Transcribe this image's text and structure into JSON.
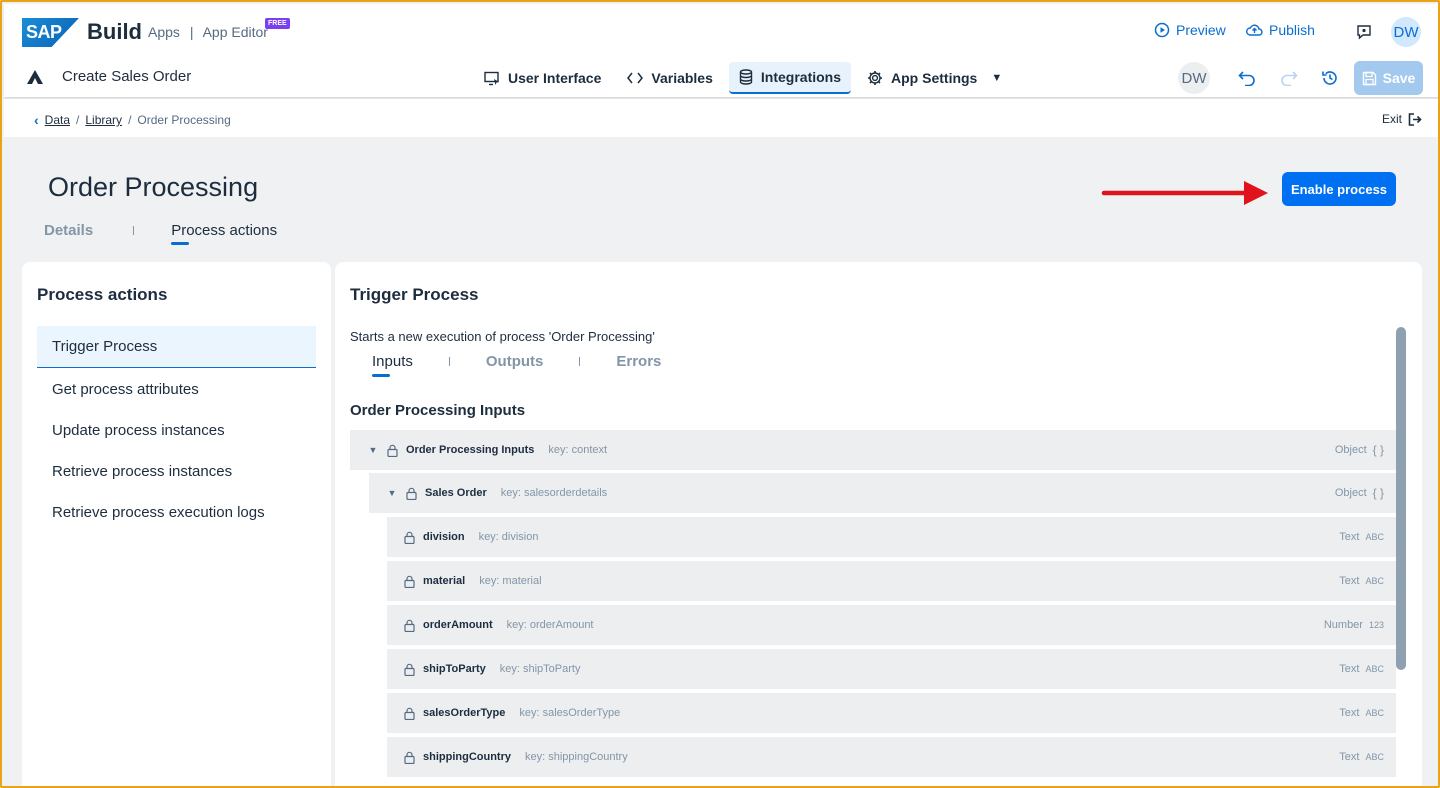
{
  "header": {
    "logo_text": "SAP",
    "product": "Build",
    "crumb_apps": "Apps",
    "crumb_sep": "|",
    "crumb_editor": "App Editor",
    "free_badge": "FREE",
    "preview_label": "Preview",
    "publish_label": "Publish",
    "user_initials": "DW",
    "app_name": "Create Sales Order",
    "tabs": [
      {
        "label": "User Interface",
        "icon": "user-interface-icon"
      },
      {
        "label": "Variables",
        "icon": "code-icon"
      },
      {
        "label": "Integrations",
        "icon": "database-icon",
        "active": true
      },
      {
        "label": "App Settings",
        "icon": "gear-icon"
      }
    ],
    "collaborator_initials": "DW",
    "save_label": "Save",
    "accent": "#0a6ed1"
  },
  "breadcrumb": {
    "items": [
      "Data",
      "Library",
      "Order Processing"
    ],
    "sep": "/",
    "exit_label": "Exit"
  },
  "page": {
    "title": "Order Processing",
    "tabs": [
      "Details",
      "Process actions"
    ],
    "active_tab": "Process actions",
    "enable_button": "Enable process"
  },
  "left_panel": {
    "title": "Process actions",
    "items": [
      "Trigger Process",
      "Get process attributes",
      "Update process instances",
      "Retrieve process instances",
      "Retrieve process execution logs"
    ]
  },
  "right_panel": {
    "title": "Trigger Process",
    "description": "Starts a new execution of process 'Order Processing'",
    "tabs": [
      "Inputs",
      "Outputs",
      "Errors"
    ],
    "section_title": "Order Processing Inputs",
    "rows": [
      {
        "name": "Order Processing Inputs",
        "key": "key: context",
        "type": "Object",
        "type_icon": "{ }"
      },
      {
        "name": "Sales Order",
        "key": "key: salesorderdetails",
        "type": "Object",
        "type_icon": "{ }"
      },
      {
        "name": "division",
        "key": "key: division",
        "type": "Text",
        "type_icon": "ABC"
      },
      {
        "name": "material",
        "key": "key: material",
        "type": "Text",
        "type_icon": "ABC"
      },
      {
        "name": "orderAmount",
        "key": "key: orderAmount",
        "type": "Number",
        "type_icon": "123"
      },
      {
        "name": "shipToParty",
        "key": "key: shipToParty",
        "type": "Text",
        "type_icon": "ABC"
      },
      {
        "name": "salesOrderType",
        "key": "key: salesOrderType",
        "type": "Text",
        "type_icon": "ABC"
      },
      {
        "name": "shippingCountry",
        "key": "key: shippingCountry",
        "type": "Text",
        "type_icon": "ABC"
      }
    ]
  }
}
